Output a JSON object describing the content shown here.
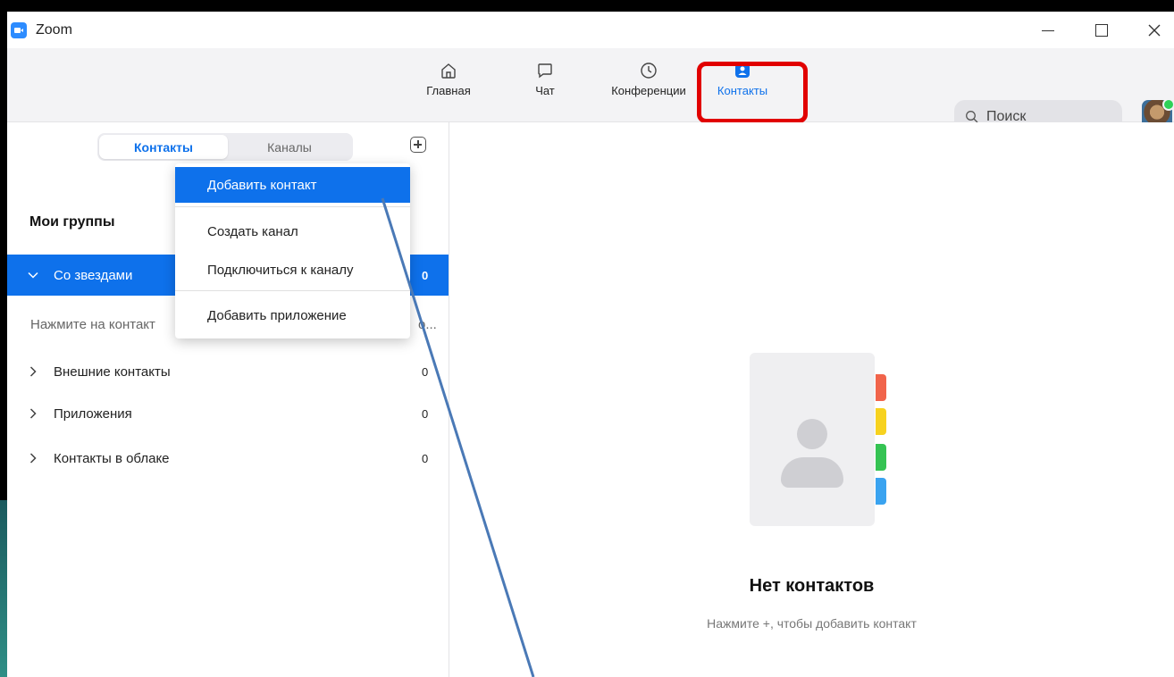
{
  "window": {
    "title": "Zoom"
  },
  "nav": {
    "home": "Главная",
    "chat": "Чат",
    "meetings": "Конференции",
    "contacts": "Контакты",
    "active_color": "#0e71eb"
  },
  "search": {
    "placeholder": "Поиск"
  },
  "tabs": {
    "contacts": "Контакты",
    "channels": "Каналы"
  },
  "groups": {
    "title": "Мои группы",
    "starred": {
      "label": "Со звездами",
      "count": "0"
    },
    "hint": "Нажмите на контакт",
    "hint_tail": "o...",
    "items": [
      {
        "label": "Внешние контакты",
        "count": "0"
      },
      {
        "label": "Приложения",
        "count": "0"
      },
      {
        "label": "Контакты в облаке",
        "count": "0"
      }
    ]
  },
  "menu": {
    "items": [
      "Добавить контакт",
      "Создать канал",
      "Подключиться к каналу",
      "Добавить приложение"
    ]
  },
  "empty_state": {
    "title": "Нет контактов",
    "subtitle": "Нажмите +, чтобы добавить контакт"
  },
  "colors": {
    "accent": "#0e71eb",
    "highlight": "#e10000",
    "tab_red": "#f1644b",
    "tab_yellow": "#f7d21f",
    "tab_green": "#35c353",
    "tab_blue": "#3aa3f0"
  }
}
